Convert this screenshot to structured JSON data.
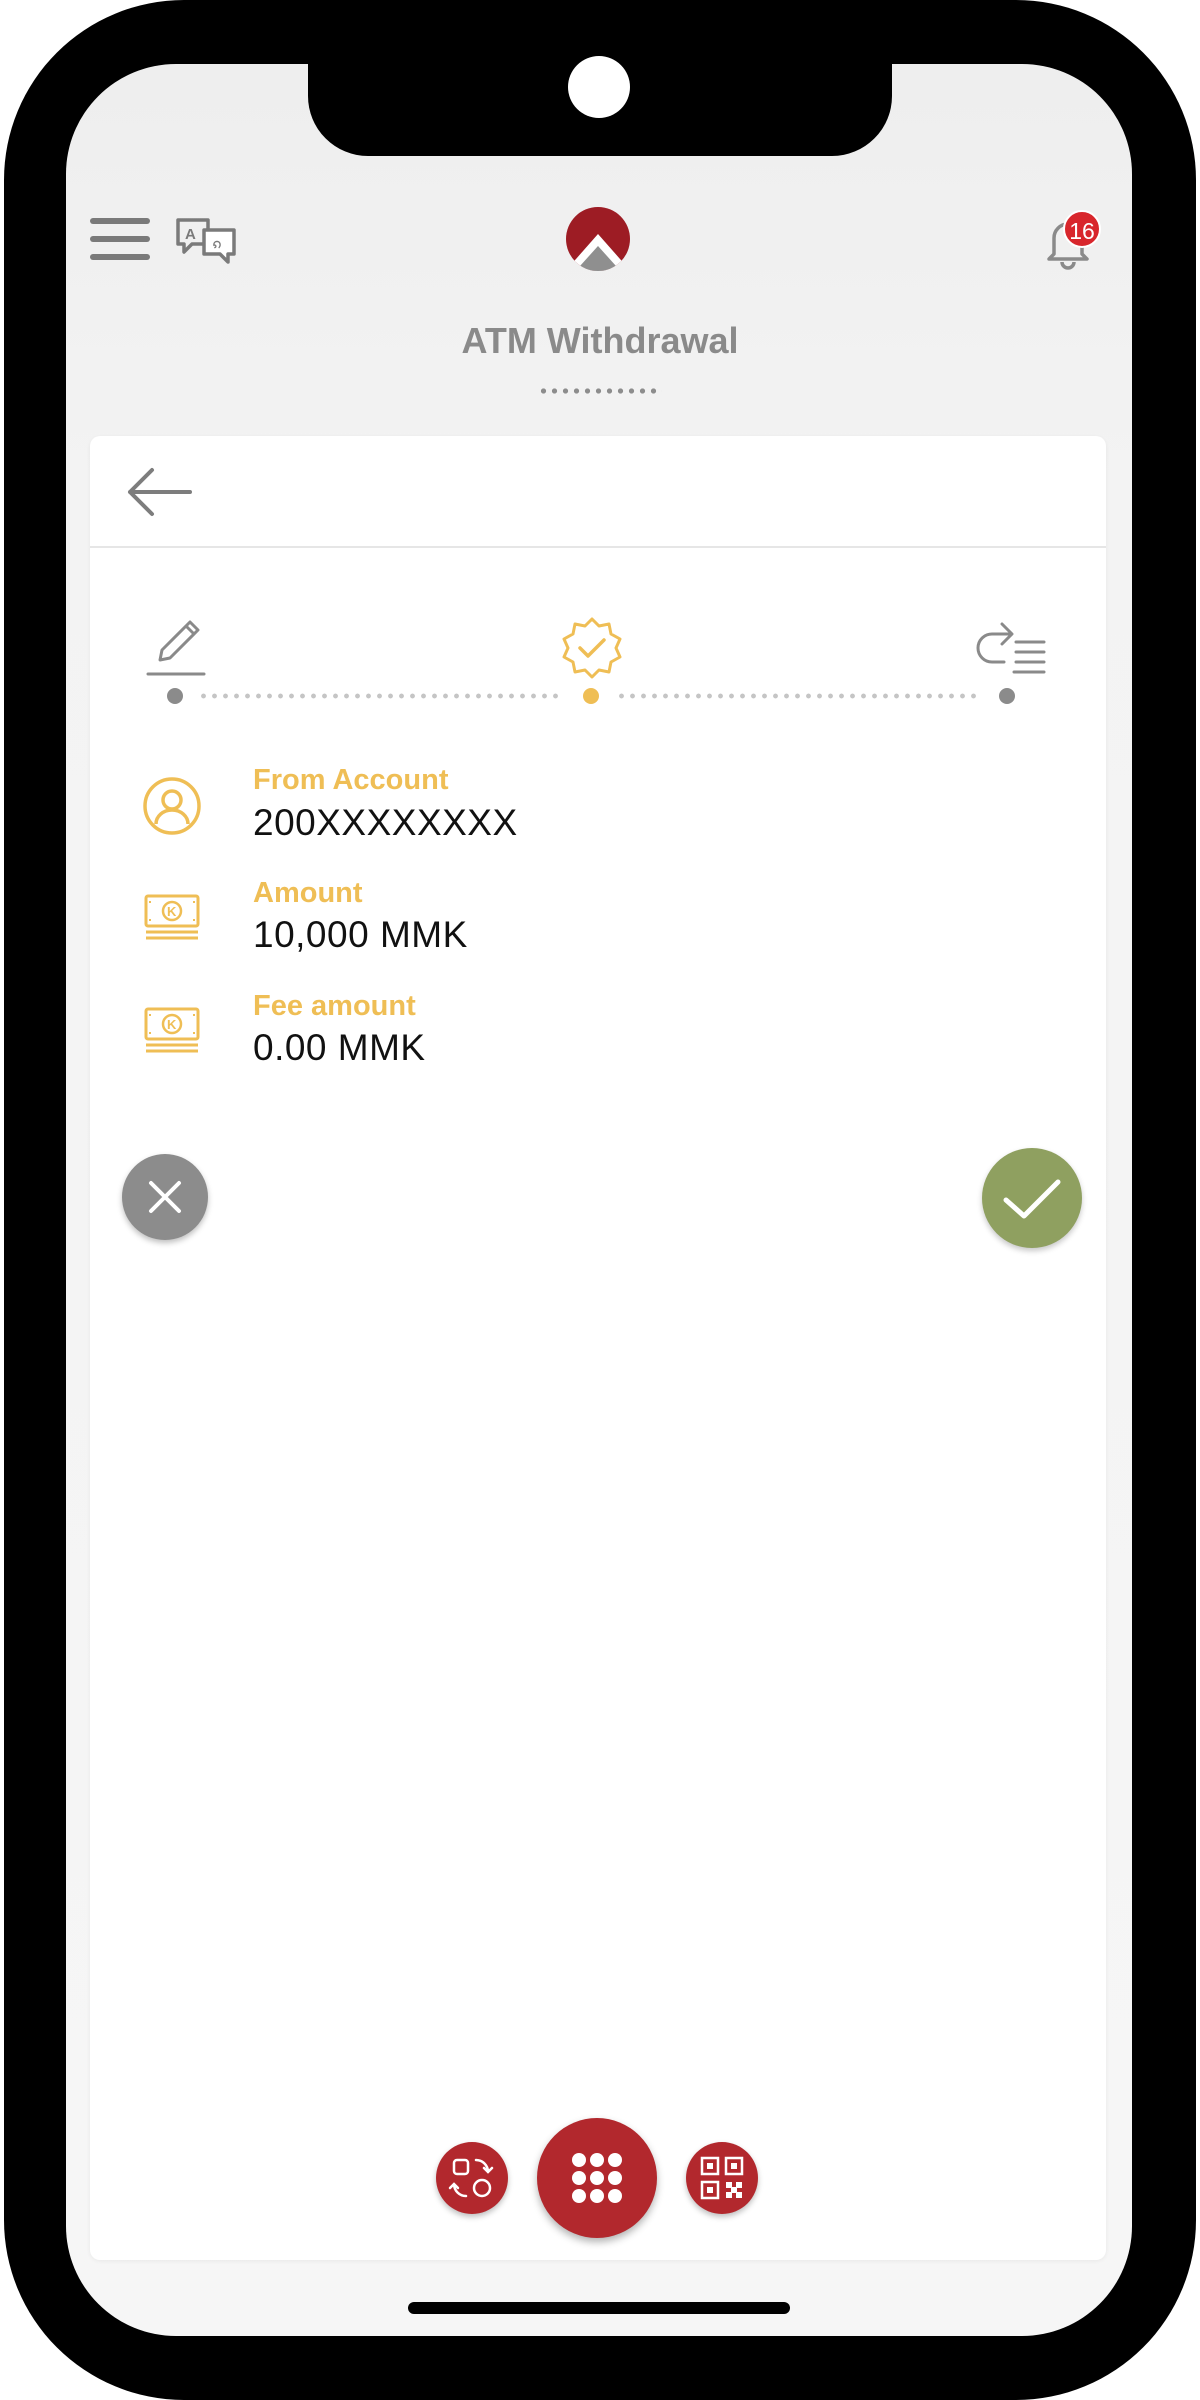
{
  "header": {
    "title": "ATM Withdrawal",
    "notification_count": "16",
    "menu_icon": "hamburger-menu-icon",
    "language_icon": "translate-icon",
    "bell_icon": "bell-icon"
  },
  "stepper": {
    "steps": [
      {
        "icon": "edit-pencil-icon",
        "state": "done"
      },
      {
        "icon": "verify-badge-icon",
        "state": "active"
      },
      {
        "icon": "result-list-icon",
        "state": "pending"
      }
    ]
  },
  "details": [
    {
      "label": "From Account",
      "value": "200XXXXXXXX",
      "icon": "account-user-icon"
    },
    {
      "label": "Amount",
      "value": "10,000 MMK",
      "icon": "cash-note-icon"
    },
    {
      "label": "Fee amount",
      "value": "0.00 MMK",
      "icon": "cash-note-icon"
    }
  ],
  "actions": {
    "cancel_icon": "close-icon",
    "confirm_icon": "checkmark-icon"
  },
  "dock": {
    "left_icon": "transfer-exchange-icon",
    "center_icon": "app-grid-icon",
    "right_icon": "qr-code-icon"
  },
  "colors": {
    "brand_red": "#b2282d",
    "accent_gold": "#efbe55",
    "confirm_green": "#8fa060",
    "cancel_gray": "#8c8c8c"
  }
}
